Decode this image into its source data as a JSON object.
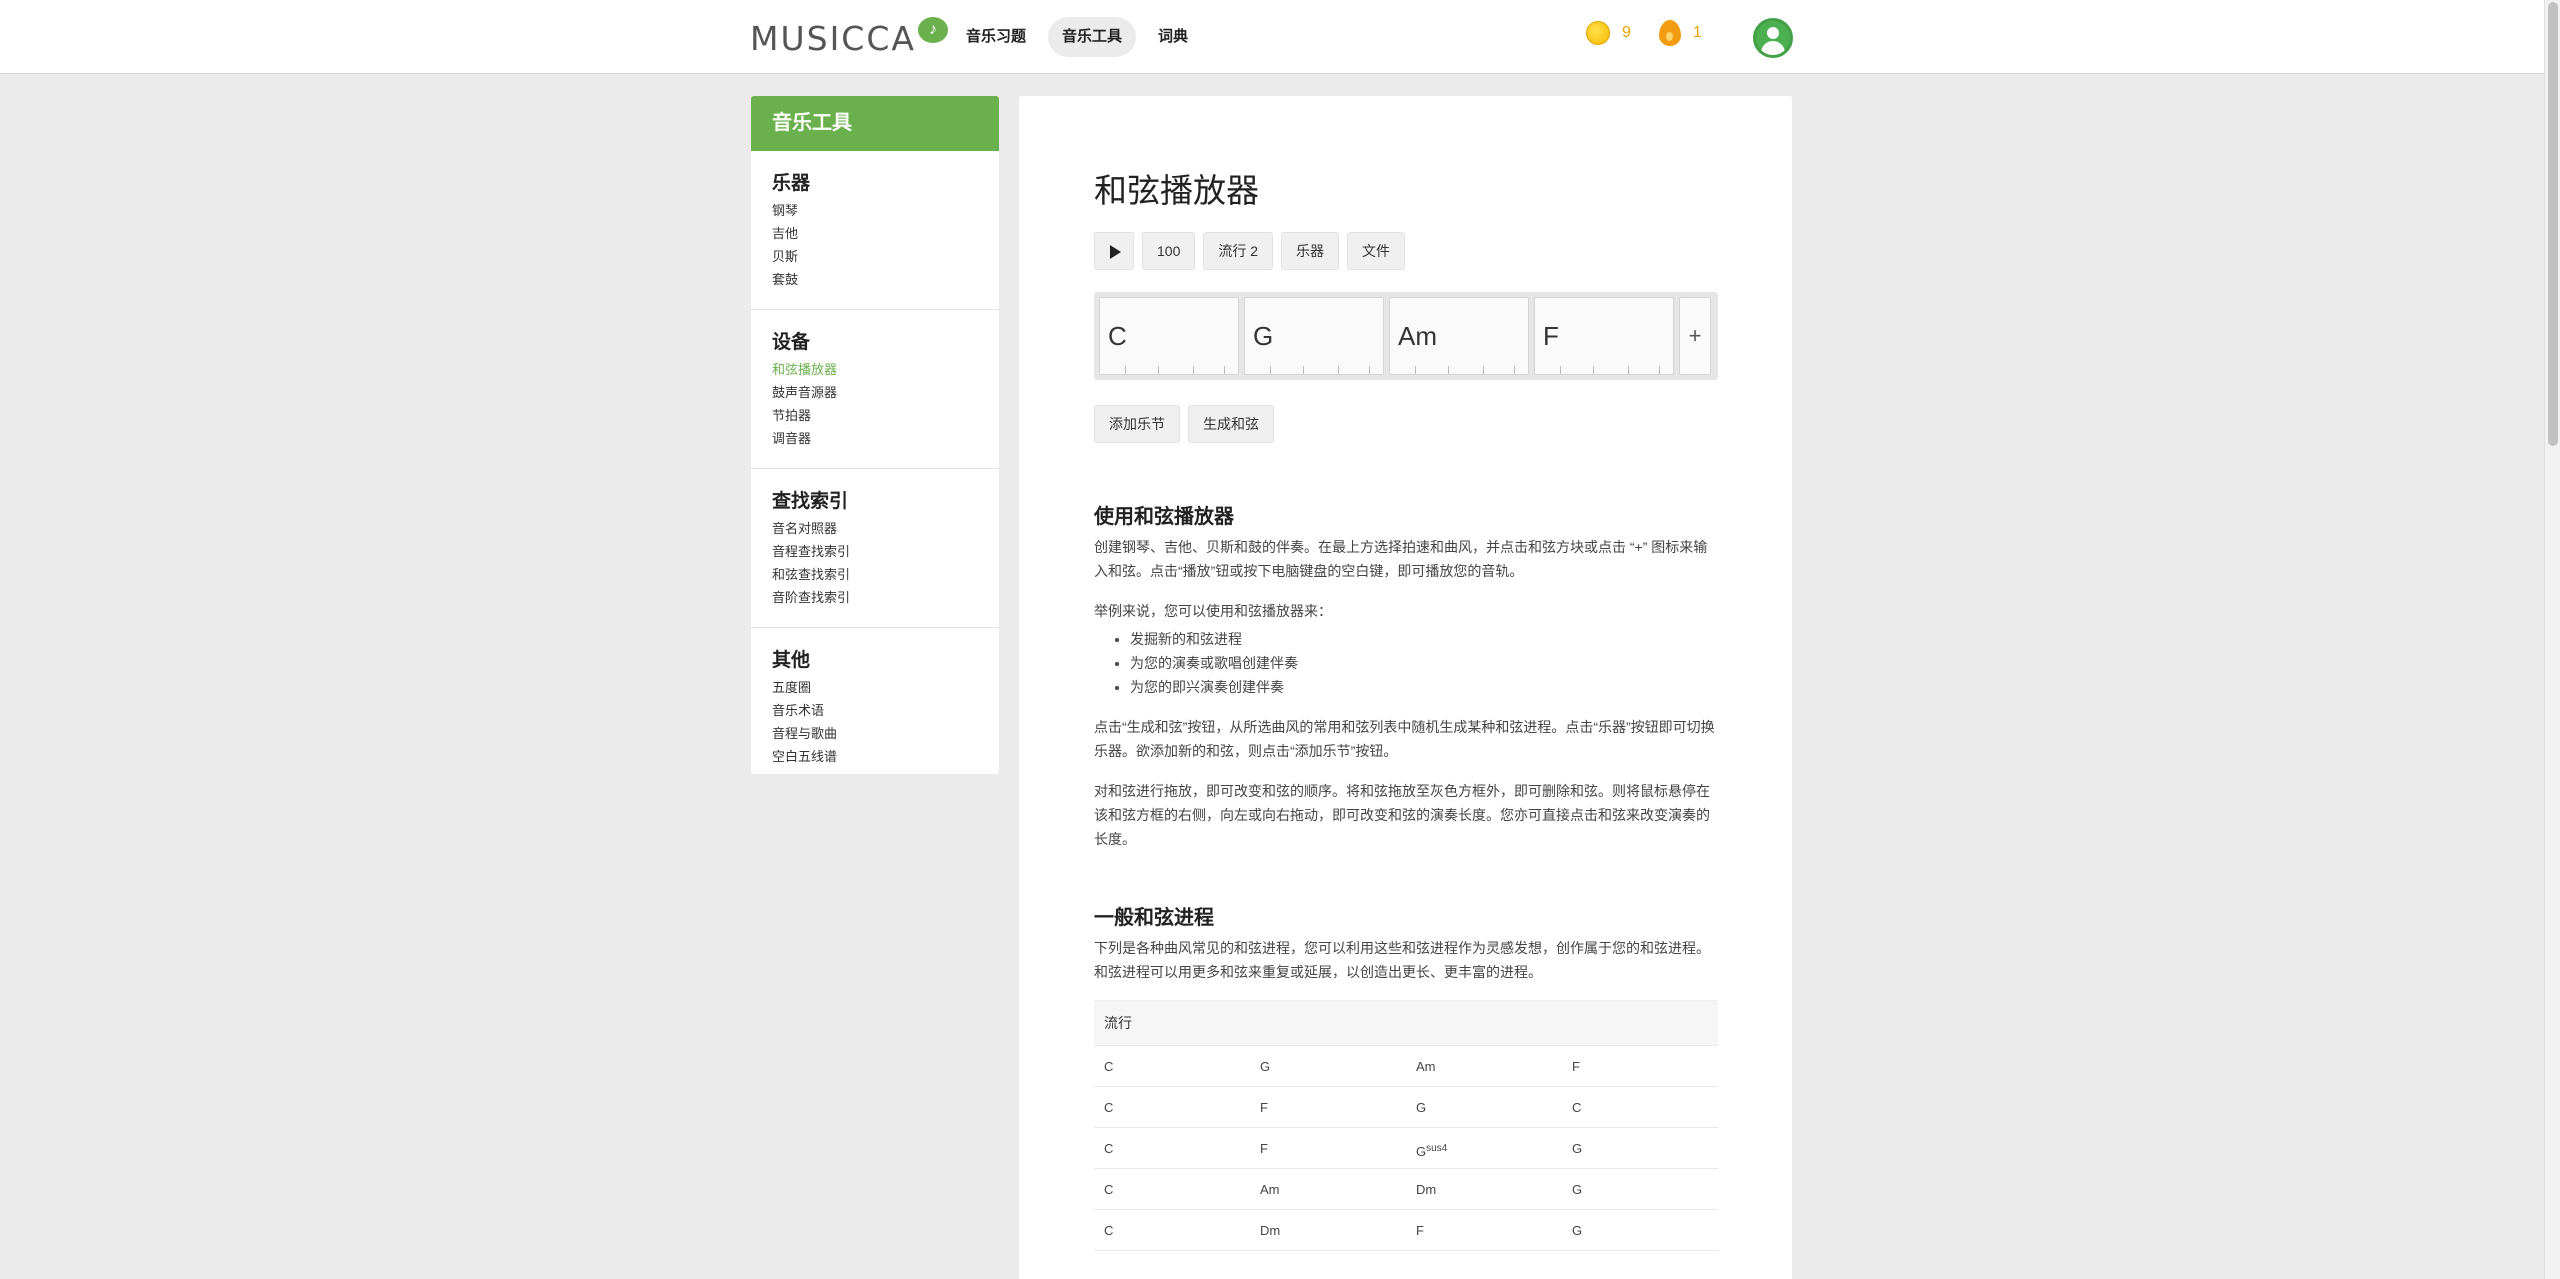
{
  "header": {
    "logo": "MUSICCA",
    "nav": [
      "音乐习题",
      "音乐工具",
      "词典"
    ],
    "active_nav": "音乐工具",
    "coins": "9",
    "streak": "1"
  },
  "sidebar": {
    "title": "音乐工具",
    "sections": [
      {
        "heading": "乐器",
        "links": [
          "钢琴",
          "吉他",
          "贝斯",
          "套鼓"
        ]
      },
      {
        "heading": "设备",
        "links": [
          "和弦播放器",
          "鼓声音源器",
          "节拍器",
          "调音器"
        ]
      },
      {
        "heading": "查找索引",
        "links": [
          "音名对照器",
          "音程查找索引",
          "和弦查找索引",
          "音阶查找索引"
        ]
      },
      {
        "heading": "其他",
        "links": [
          "五度圈",
          "音乐术语",
          "音程与歌曲",
          "空白五线谱"
        ]
      }
    ],
    "active_link": "和弦播放器"
  },
  "main": {
    "title": "和弦播放器",
    "toolbar": {
      "tempo": "100",
      "style": "流行 2",
      "instrument": "乐器",
      "file": "文件"
    },
    "chords": [
      "C",
      "G",
      "Am",
      "F"
    ],
    "add_chord_label": "+",
    "actions": {
      "add_bar": "添加乐节",
      "generate": "生成和弦"
    },
    "section1": {
      "heading": "使用和弦播放器",
      "p1": "创建钢琴、吉他、贝斯和鼓的伴奏。在最上方选择拍速和曲风，并点击和弦方块或点击 “+” 图标来输入和弦。点击“播放”钮或按下电脑键盘的空白键，即可播放您的音轨。",
      "p2": "举例来说，您可以使用和弦播放器来：",
      "bullets": [
        "发掘新的和弦进程",
        "为您的演奏或歌唱创建伴奏",
        "为您的即兴演奏创建伴奏"
      ],
      "p3": "点击“生成和弦”按钮，从所选曲风的常用和弦列表中随机生成某种和弦进程。点击“乐器”按钮即可切换乐器。欲添加新的和弦，则点击“添加乐节”按钮。",
      "p4": "对和弦进行拖放，即可改变和弦的顺序。将和弦拖放至灰色方框外，即可删除和弦。则将鼠标悬停在该和弦方框的右侧，向左或向右拖动，即可改变和弦的演奏长度。您亦可直接点击和弦来改变演奏的长度。"
    },
    "section2": {
      "heading": "一般和弦进程",
      "p1": "下列是各种曲风常见的和弦进程，您可以利用这些和弦进程作为灵感发想，创作属于您的和弦进程。和弦进程可以用更多和弦来重复或延展，以创造出更长、更丰富的进程。",
      "table_header": "流行",
      "rows": [
        [
          "C",
          "G",
          "Am",
          "F"
        ],
        [
          "C",
          "F",
          "G",
          "C"
        ],
        [
          "C",
          "F",
          "G",
          "G"
        ],
        [
          "C",
          "Am",
          "Dm",
          "G"
        ],
        [
          "C",
          "Dm",
          "F",
          "G"
        ]
      ],
      "row3_sus": "sus4"
    }
  }
}
